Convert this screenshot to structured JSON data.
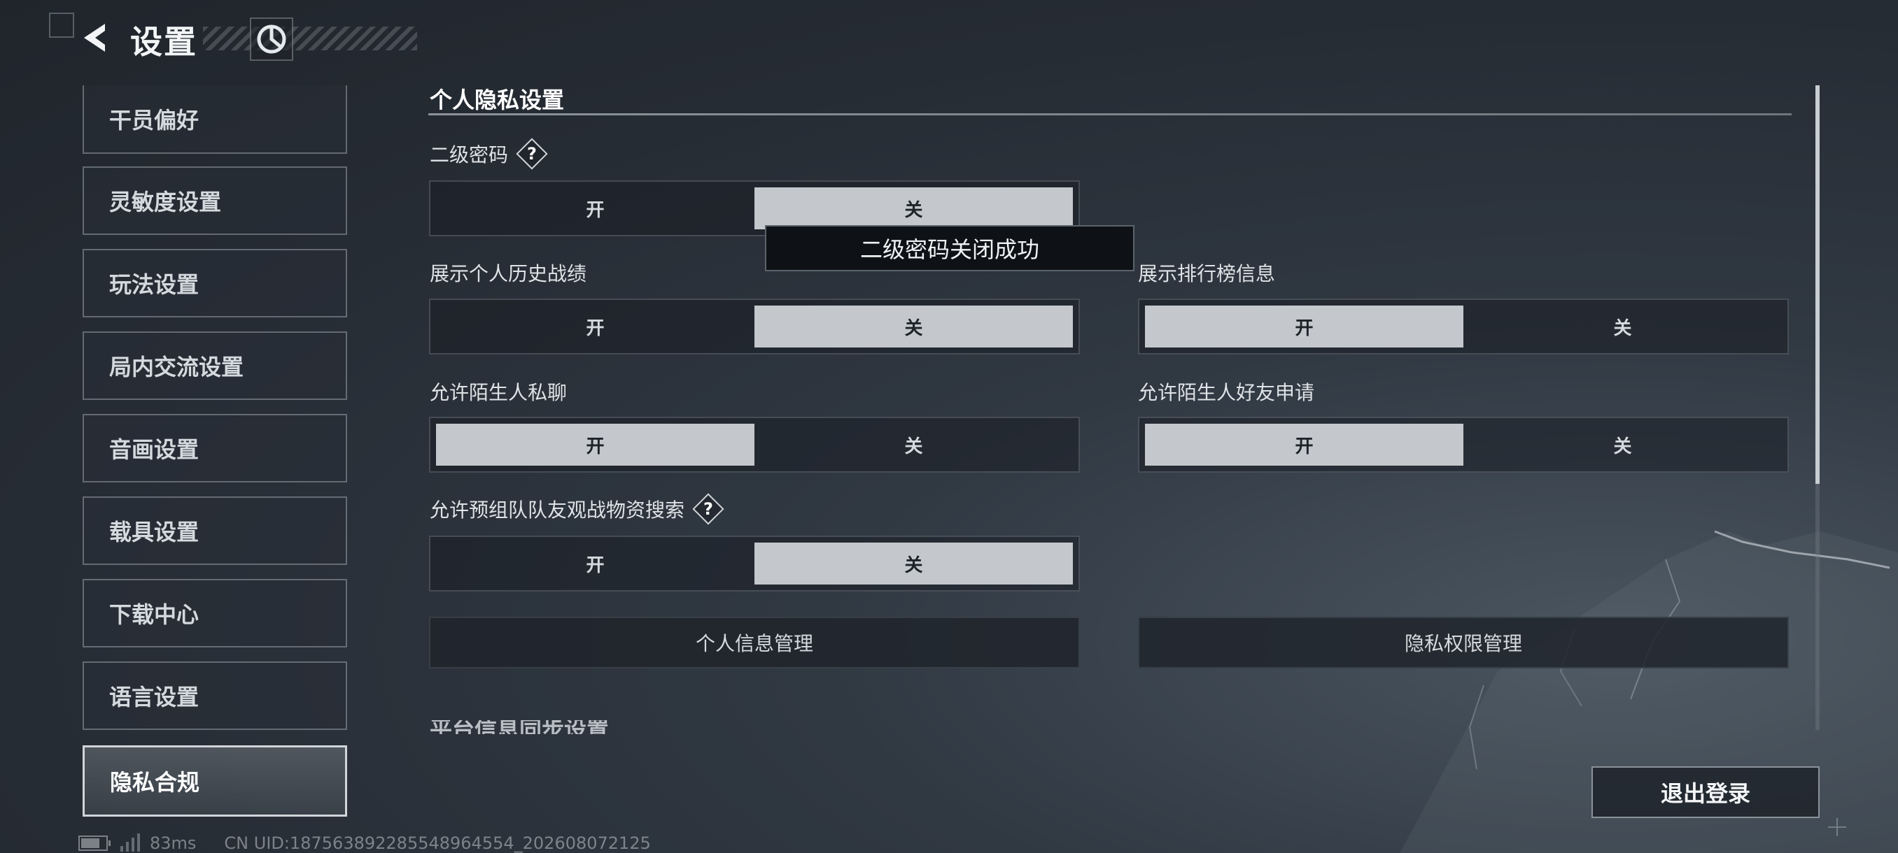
{
  "header": {
    "title": "设置",
    "back_icon": "back-arrow-icon",
    "logo_icon": "game-logo-icon"
  },
  "sidebar": {
    "items": [
      {
        "label": "干员偏好",
        "active": false
      },
      {
        "label": "灵敏度设置",
        "active": false
      },
      {
        "label": "玩法设置",
        "active": false
      },
      {
        "label": "局内交流设置",
        "active": false
      },
      {
        "label": "音画设置",
        "active": false
      },
      {
        "label": "载具设置",
        "active": false
      },
      {
        "label": "下载中心",
        "active": false
      },
      {
        "label": "语言设置",
        "active": false
      },
      {
        "label": "隐私合规",
        "active": true
      }
    ]
  },
  "status": {
    "ping": "83ms",
    "uid": "CN UID:18756389228554896455­4_202608072125"
  },
  "main": {
    "section_title": "个人隐私设置",
    "settings": [
      {
        "label": "二级密码",
        "has_help": true,
        "on_label": "开",
        "off_label": "关",
        "selected": "off"
      },
      {
        "label": "展示个人历史战绩",
        "has_help": false,
        "on_label": "开",
        "off_label": "关",
        "selected": "off"
      },
      {
        "label": "展示排行榜信息",
        "has_help": false,
        "on_label": "开",
        "off_label": "关",
        "selected": "on"
      },
      {
        "label": "允许陌生人私聊",
        "has_help": false,
        "on_label": "开",
        "off_label": "关",
        "selected": "on"
      },
      {
        "label": "允许陌生人好友申请",
        "has_help": false,
        "on_label": "开",
        "off_label": "关",
        "selected": "on"
      },
      {
        "label": "允许预组队队友观战物资搜索",
        "has_help": true,
        "on_label": "开",
        "off_label": "关",
        "selected": "off"
      }
    ],
    "help_glyph": "?",
    "toast": "二级密码关闭成功",
    "buttons": {
      "personal_info": "个人信息管理",
      "privacy_permissions": "隐私权限管理"
    },
    "next_section_partial": "平台信息同步设置"
  },
  "footer": {
    "logout": "退出登录"
  },
  "colors": {
    "selected_option_bg": "#c4c8cc",
    "background": "#262c34",
    "toast_bg": "#0e1216"
  }
}
